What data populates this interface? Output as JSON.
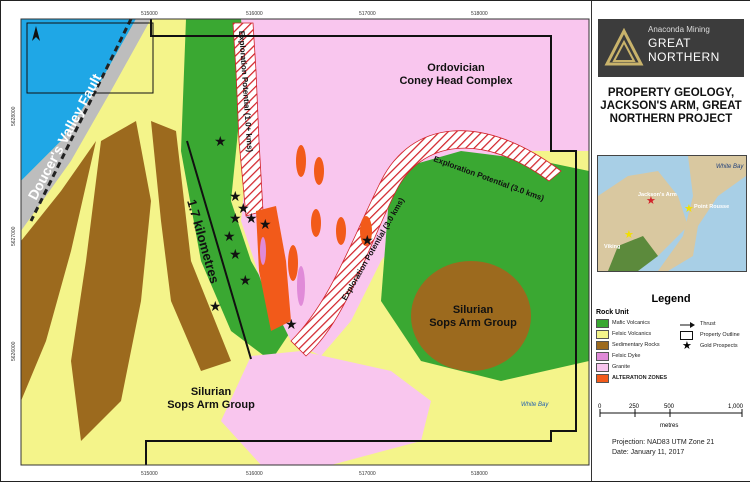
{
  "logo": {
    "line1": "Anaconda Mining",
    "line2": "GREAT",
    "line3": "NORTHERN"
  },
  "title": "PROPERTY GEOLOGY, JACKSON'S ARM, GREAT NORTHERN PROJECT",
  "map_labels": {
    "ordovician": "Ordovician",
    "coney": "Coney Head Complex",
    "silurian_right_1": "Silurian",
    "silurian_right_2": "Sops Arm Group",
    "silurian_bottom_1": "Silurian",
    "silurian_bottom_2": "Sops Arm Group",
    "fault": "Doucer's Valley Fault",
    "expl1": "Exploration Potential (1.0+ kms)",
    "expl2": "Exploration Potential (3.0 kms)",
    "expl3": "Exploration Potential (3.0 kms)",
    "km": "1.7 kilometres",
    "white_bay": "White Bay"
  },
  "grid": {
    "eastings": [
      "515000",
      "516000",
      "517000",
      "518000"
    ],
    "northings": [
      "5628000",
      "5627000",
      "5626000"
    ]
  },
  "inset": {
    "white_bay": "White Bay",
    "jacksons_arm": "Jackson's Arm",
    "point_rousse": "Point Rousse",
    "viking": "Viking"
  },
  "legend": {
    "title": "Legend",
    "rock_unit": "Rock Unit",
    "items": [
      {
        "label": "Mafic Volcanics",
        "color": "#3aa832"
      },
      {
        "label": "Felsic Volcanics",
        "color": "#f4f48a"
      },
      {
        "label": "Sedimentary Rocks",
        "color": "#9c6a1e"
      },
      {
        "label": "Felsic Dyke",
        "color": "#e08ad8"
      },
      {
        "label": "Granite",
        "color": "#f9c6ee"
      },
      {
        "label": "ALTERATION ZONES",
        "color": "#f25a1a"
      }
    ],
    "thrust": "Thrust",
    "outline": "Property Outline",
    "gold": "Gold Prospects"
  },
  "scale": {
    "ticks": [
      "0",
      "250",
      "500",
      "1,000"
    ],
    "unit": "metres"
  },
  "footer": {
    "projection": "Projection:  NAD83 UTM Zone 21",
    "date": "Date:  January 11, 2017"
  }
}
